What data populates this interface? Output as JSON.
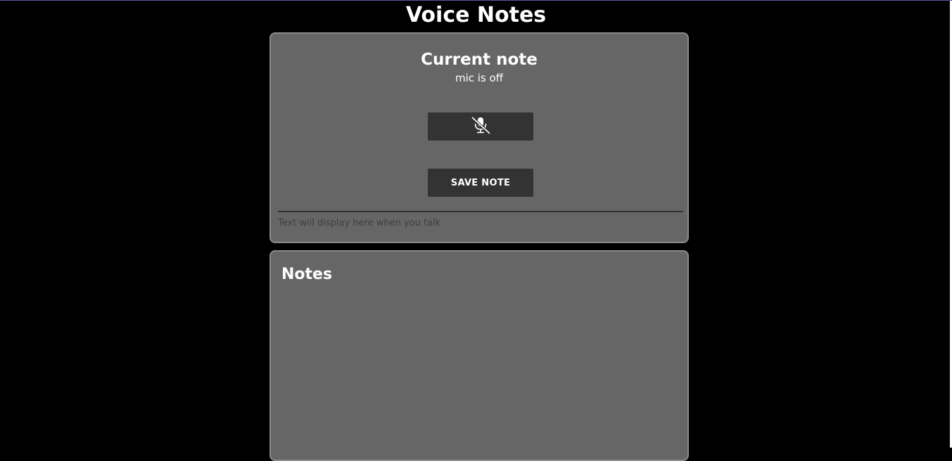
{
  "app": {
    "title": "Voice Notes"
  },
  "current_note": {
    "title": "Current note",
    "mic_status": "mic is off",
    "mic_button_icon": "microphone-off-icon",
    "save_button_label": "SAVE NOTE",
    "transcript_placeholder": "Text will display here when you talk"
  },
  "notes": {
    "title": "Notes",
    "items": []
  },
  "colors": {
    "background": "#000000",
    "card": "#666666",
    "button": "#333333",
    "text": "#ffffff"
  }
}
